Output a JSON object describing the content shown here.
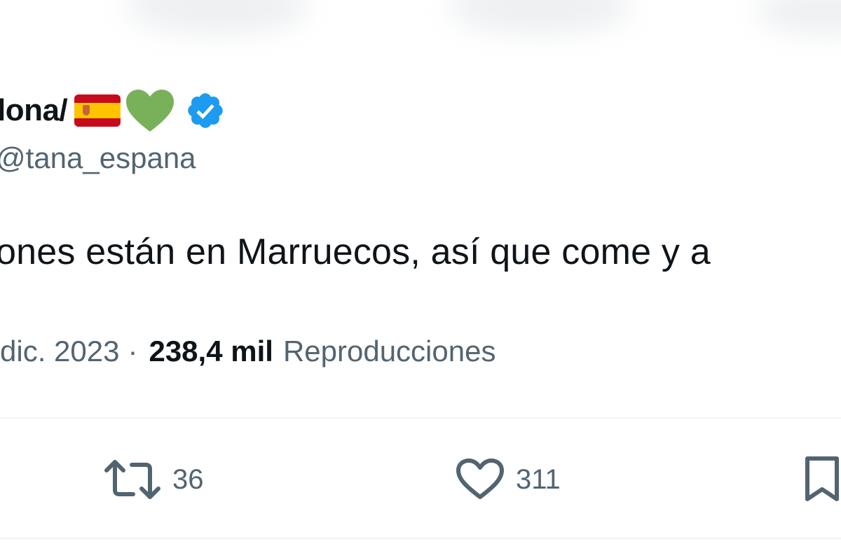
{
  "tweet": {
    "display_name": "lona/",
    "flag_emoji": "spain-flag",
    "heart_emoji": "green-heart",
    "verified": true,
    "handle": "tana_espana",
    "text": "ones están en Marruecos, así que come y a",
    "date": "dic. 2023",
    "separator": "·",
    "views_count": "238,4 mil",
    "views_label": "Reproducciones"
  },
  "actions": {
    "retweet_count": "36",
    "like_count": "311"
  },
  "colors": {
    "text_primary": "#0f1419",
    "text_secondary": "#536471",
    "verified_blue": "#1d9bf0",
    "heart_green": "#78b159",
    "divider": "#eff3f4"
  }
}
